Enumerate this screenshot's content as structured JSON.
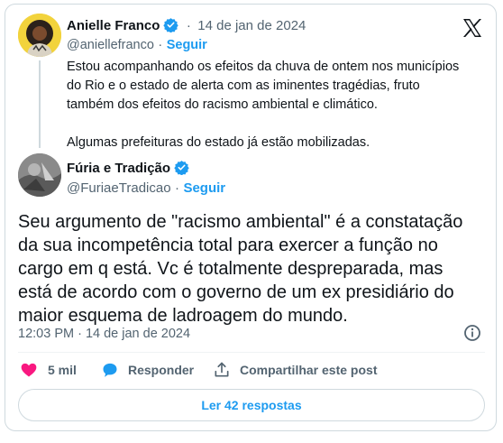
{
  "quoted_tweet": {
    "author_name": "Anielle Franco",
    "separator": "·",
    "date": "14 de jan de 2024",
    "handle": "@aniellefranco",
    "follow_label": "Seguir",
    "paragraphs": [
      "Estou acompanhando os efeitos da chuva de ontem nos municípios do Rio e o estado de alerta com as iminentes tragédias, fruto também dos efeitos do racismo ambiental e climático.",
      "Algumas prefeituras do estado já estão mobilizadas."
    ]
  },
  "reply_tweet": {
    "author_name": "Fúria e Tradição",
    "handle": "@FuriaeTradicao",
    "separator": "·",
    "follow_label": "Seguir",
    "text": "Seu argumento de \"racismo ambiental\" é a constatação da sua  incompetência total para exercer a função no cargo em q está. Vc é totalmente despreparada, mas está de acordo com o governo de um ex presidiário do maior esquema de ladroagem do mundo.",
    "timestamp": "12:03 PM · 14 de jan de 2024"
  },
  "actions": {
    "likes_count": "5 mil",
    "reply_label": "Responder",
    "share_label": "Compartilhar este post"
  },
  "read_replies_label": "Ler 42 respostas",
  "icons": {
    "brand": "x-logo-icon",
    "verified": "verified-badge-icon",
    "like": "heart-icon",
    "reply": "speech-bubble-icon",
    "share": "share-arrow-icon",
    "info": "info-icon"
  },
  "colors": {
    "accent": "#1d9bf0",
    "like": "#f91880",
    "muted_text": "#536471",
    "border": "#cfd9de"
  }
}
